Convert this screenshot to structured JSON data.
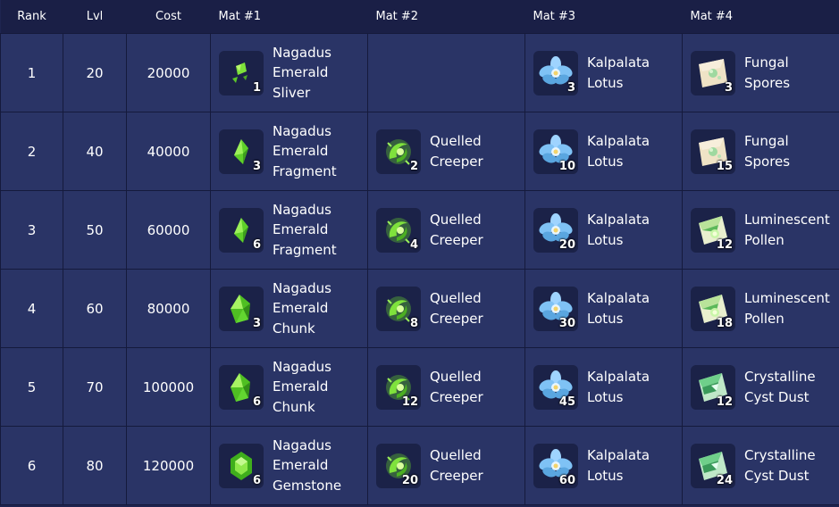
{
  "columns": {
    "rank": "Rank",
    "lvl": "Lvl",
    "cost": "Cost",
    "mat1": "Mat #1",
    "mat2": "Mat #2",
    "mat3": "Mat #3",
    "mat4": "Mat #4"
  },
  "rows": [
    {
      "rank": "1",
      "lvl": "20",
      "cost": "20000",
      "mat1": {
        "name": "Nagadus\nEmerald\nSliver",
        "count": "1",
        "icon": "emerald-sliver-icon"
      },
      "mat2": null,
      "mat3": {
        "name": "Kalpalata\nLotus",
        "count": "3",
        "icon": "lotus-icon"
      },
      "mat4": {
        "name": "Fungal\nSpores",
        "count": "3",
        "icon": "fungal-spores-icon"
      }
    },
    {
      "rank": "2",
      "lvl": "40",
      "cost": "40000",
      "mat1": {
        "name": "Nagadus\nEmerald\nFragment",
        "count": "3",
        "icon": "emerald-fragment-icon"
      },
      "mat2": {
        "name": "Quelled\nCreeper",
        "count": "2",
        "icon": "creeper-icon"
      },
      "mat3": {
        "name": "Kalpalata\nLotus",
        "count": "10",
        "icon": "lotus-icon"
      },
      "mat4": {
        "name": "Fungal\nSpores",
        "count": "15",
        "icon": "fungal-spores-icon"
      }
    },
    {
      "rank": "3",
      "lvl": "50",
      "cost": "60000",
      "mat1": {
        "name": "Nagadus\nEmerald\nFragment",
        "count": "6",
        "icon": "emerald-fragment-icon"
      },
      "mat2": {
        "name": "Quelled\nCreeper",
        "count": "4",
        "icon": "creeper-icon"
      },
      "mat3": {
        "name": "Kalpalata\nLotus",
        "count": "20",
        "icon": "lotus-icon"
      },
      "mat4": {
        "name": "Luminescent\nPollen",
        "count": "12",
        "icon": "luminescent-pollen-icon"
      }
    },
    {
      "rank": "4",
      "lvl": "60",
      "cost": "80000",
      "mat1": {
        "name": "Nagadus\nEmerald\nChunk",
        "count": "3",
        "icon": "emerald-chunk-icon"
      },
      "mat2": {
        "name": "Quelled\nCreeper",
        "count": "8",
        "icon": "creeper-icon"
      },
      "mat3": {
        "name": "Kalpalata\nLotus",
        "count": "30",
        "icon": "lotus-icon"
      },
      "mat4": {
        "name": "Luminescent\nPollen",
        "count": "18",
        "icon": "luminescent-pollen-icon"
      }
    },
    {
      "rank": "5",
      "lvl": "70",
      "cost": "100000",
      "mat1": {
        "name": "Nagadus\nEmerald\nChunk",
        "count": "6",
        "icon": "emerald-chunk-icon"
      },
      "mat2": {
        "name": "Quelled\nCreeper",
        "count": "12",
        "icon": "creeper-icon"
      },
      "mat3": {
        "name": "Kalpalata\nLotus",
        "count": "45",
        "icon": "lotus-icon"
      },
      "mat4": {
        "name": "Crystalline\nCyst Dust",
        "count": "12",
        "icon": "cyst-dust-icon"
      }
    },
    {
      "rank": "6",
      "lvl": "80",
      "cost": "120000",
      "mat1": {
        "name": "Nagadus\nEmerald\nGemstone",
        "count": "6",
        "icon": "emerald-gemstone-icon"
      },
      "mat2": {
        "name": "Quelled\nCreeper",
        "count": "20",
        "icon": "creeper-icon"
      },
      "mat3": {
        "name": "Kalpalata\nLotus",
        "count": "60",
        "icon": "lotus-icon"
      },
      "mat4": {
        "name": "Crystalline\nCyst Dust",
        "count": "24",
        "icon": "cyst-dust-icon"
      }
    }
  ],
  "colors": {
    "header_bg": "#1a1f46",
    "row_bg": "#2a3466",
    "border": "#151a3c",
    "icon_bg": "#1b2248",
    "text": "#ffffff"
  }
}
